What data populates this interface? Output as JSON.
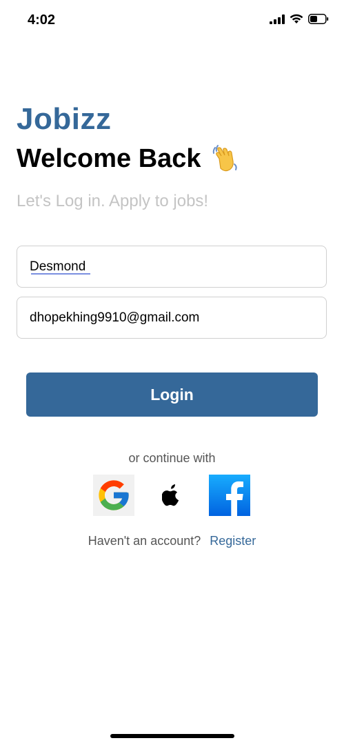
{
  "status_bar": {
    "time": "4:02",
    "icons": [
      "cellular-signal-icon",
      "wifi-icon",
      "battery-icon"
    ]
  },
  "brand": "Jobizz",
  "welcome": {
    "title": "Welcome Back",
    "emoji_icon": "waving-hand-icon"
  },
  "subtitle": "Let's Log in. Apply to jobs!",
  "form": {
    "name_value": "Desmond",
    "email_value": "dhopekhing9910@gmail.com"
  },
  "login_label": "Login",
  "continue_text": "or continue with",
  "social": [
    "google-icon",
    "apple-icon",
    "facebook-icon"
  ],
  "register": {
    "prompt": "Haven't an account?",
    "link": "Register"
  },
  "colors": {
    "accent": "#356899",
    "muted": "#c4c4c4",
    "text_secondary": "#555555"
  }
}
